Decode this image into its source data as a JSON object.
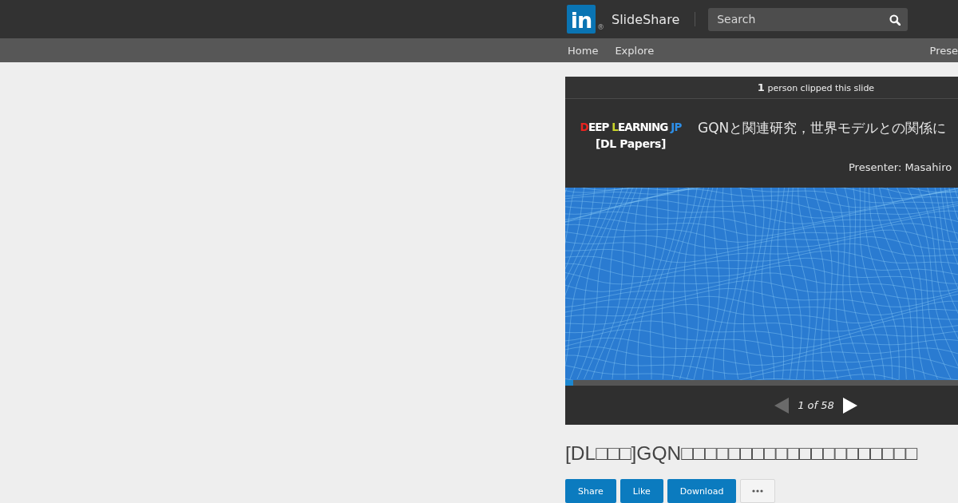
{
  "header": {
    "logo_text": "in",
    "registered_mark": "®",
    "brand": "SlideShare",
    "search": {
      "placeholder": "Search"
    }
  },
  "nav": {
    "items": [
      {
        "label": "Home"
      },
      {
        "label": "Explore"
      }
    ],
    "right_item": "Prese"
  },
  "player": {
    "clip_notice": "**1** person clipped this slide",
    "slide": {
      "logo": [
        {
          "text": "DEEP"
        },
        {
          "text": "LEARNING"
        },
        {
          "text": "JP"
        }
      ],
      "logo_subtitle": "[DL Papers]",
      "title": "GQNと関連研究，世界モデルとの関係に",
      "presenter": "Presenter: Masahiro"
    },
    "progress": {
      "level": 0.02
    },
    "controls": {
      "prev": {
        "disabled": true
      },
      "page": "1 of 58",
      "next": {
        "disabled": false
      }
    }
  },
  "title": "[DL□□□]GQN□□□□□□□□□□□□□□□□□□□□",
  "actions": [
    {
      "kind": "share",
      "label": "Share"
    },
    {
      "kind": "like",
      "label": "Like"
    },
    {
      "kind": "download",
      "label": "Download"
    },
    {
      "kind": "more"
    }
  ]
}
